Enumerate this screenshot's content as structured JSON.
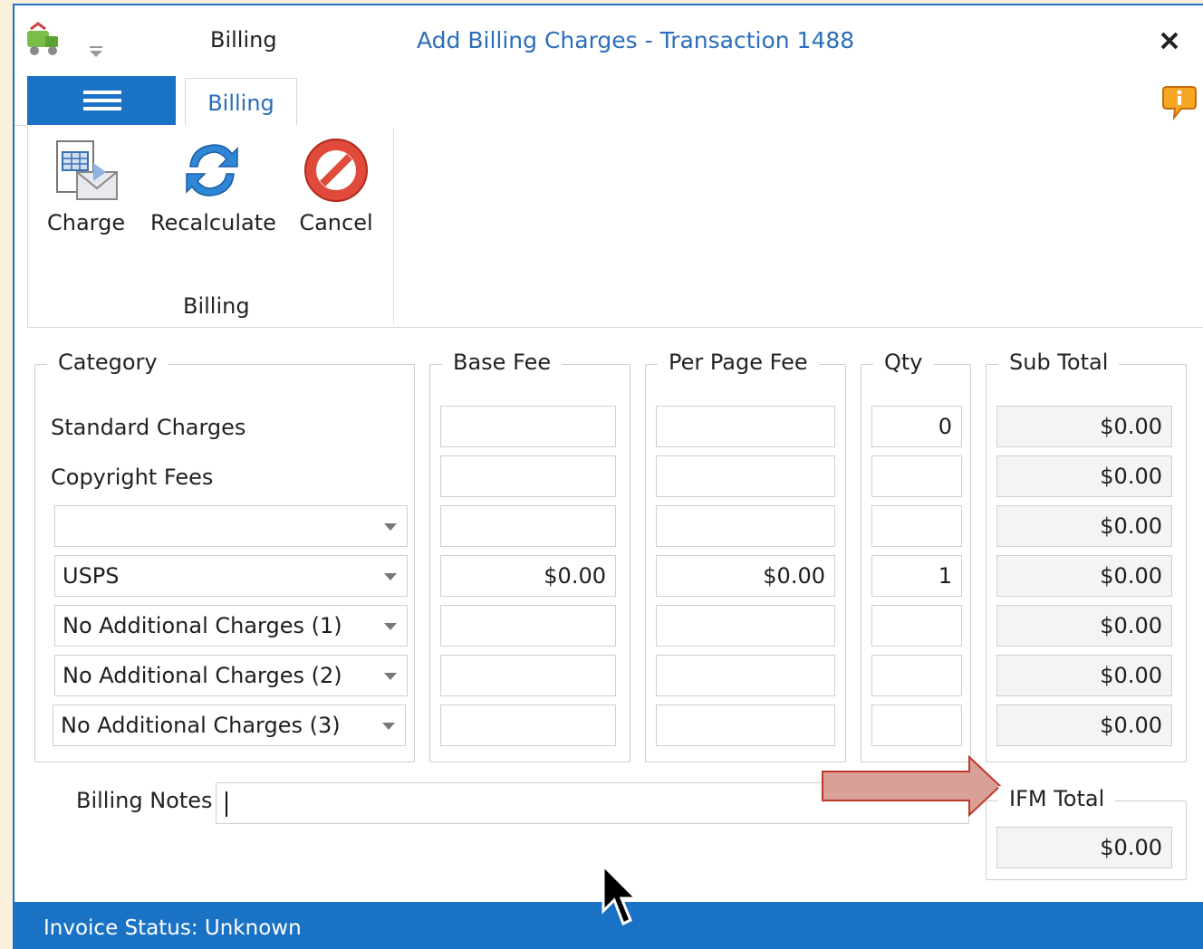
{
  "titlebar": {
    "tab_label": "Billing",
    "window_title": "Add Billing Charges - Transaction 1488",
    "close_symbol": "✕"
  },
  "ribbon": {
    "tab_label": "Billing",
    "buttons": {
      "charge": "Charge",
      "recalculate": "Recalculate",
      "cancel": "Cancel"
    },
    "group_label": "Billing"
  },
  "form": {
    "headers": {
      "category": "Category",
      "base_fee": "Base Fee",
      "per_page_fee": "Per Page Fee",
      "qty": "Qty",
      "sub_total": "Sub Total"
    },
    "rows": [
      {
        "category": "Standard Charges",
        "base_fee": "",
        "per_page_fee": "",
        "qty": "0",
        "sub_total": "$0.00"
      },
      {
        "category": "Copyright Fees",
        "base_fee": "",
        "per_page_fee": "",
        "qty": "",
        "sub_total": "$0.00"
      },
      {
        "category": "",
        "base_fee": "",
        "per_page_fee": "",
        "qty": "",
        "sub_total": "$0.00"
      },
      {
        "category": "USPS",
        "base_fee": "$0.00",
        "per_page_fee": "$0.00",
        "qty": "1",
        "sub_total": "$0.00"
      },
      {
        "category": "No Additional Charges (1)",
        "base_fee": "",
        "per_page_fee": "",
        "qty": "",
        "sub_total": "$0.00"
      },
      {
        "category": "No Additional Charges (2)",
        "base_fee": "",
        "per_page_fee": "",
        "qty": "",
        "sub_total": "$0.00"
      },
      {
        "category": "No Additional Charges (3)",
        "base_fee": "",
        "per_page_fee": "",
        "qty": "",
        "sub_total": "$0.00"
      }
    ],
    "billing_notes_label": "Billing Notes",
    "billing_notes_value": "",
    "ifm_total_label": "IFM Total",
    "ifm_total_value": "$0.00"
  },
  "status": {
    "text": "Invoice Status: Unknown"
  },
  "colors": {
    "accent": "#1a72c4",
    "title_text": "#2a6ebb",
    "callout_arrow": "#d9a098"
  }
}
